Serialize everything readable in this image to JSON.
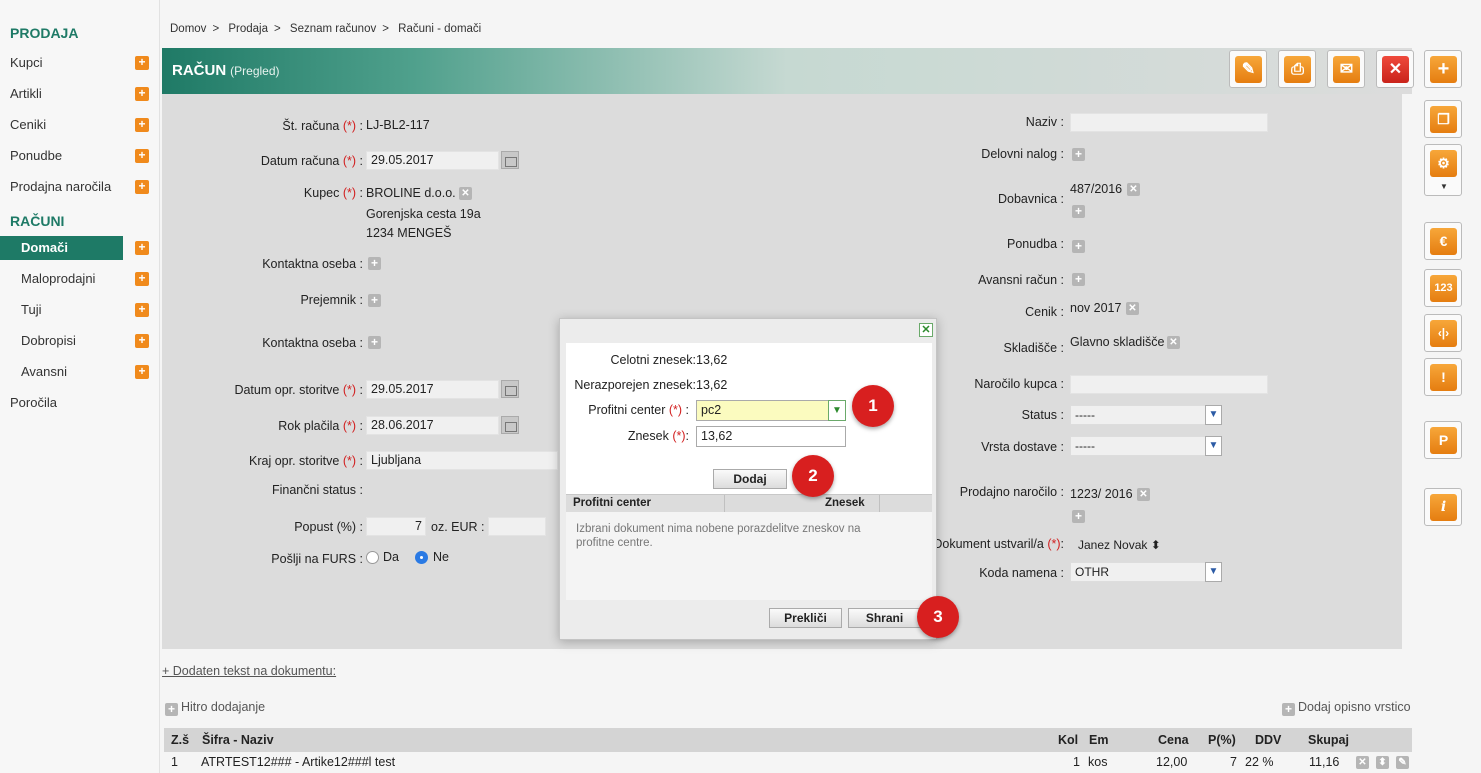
{
  "sidebar": {
    "section1": "PRODAJA",
    "items1": [
      "Kupci",
      "Artikli",
      "Ceniki",
      "Ponudbe",
      "Prodajna naročila"
    ],
    "section2": "RAČUNI",
    "items2": [
      "Domači",
      "Maloprodajni",
      "Tuji",
      "Dobropisi",
      "Avansni"
    ],
    "reports": "Poročila"
  },
  "breadcrumb": [
    "Domov",
    "Prodaja",
    "Seznam računov",
    "Računi - domači"
  ],
  "header": {
    "title": "RAČUN",
    "subtitle": "(Pregled)"
  },
  "form_left": {
    "invoice_no_label": "Št. računa",
    "invoice_no": "LJ-BL2-117",
    "invoice_date_label": "Datum računa",
    "invoice_date": "29.05.2017",
    "customer_label": "Kupec",
    "customer_name": "BROLINE d.o.o.",
    "customer_street": "Gorenjska cesta 19a",
    "customer_city": "1234 MENGEŠ",
    "contact_label": "Kontaktna oseba",
    "recipient_label": "Prejemnik",
    "contact2_label": "Kontaktna oseba",
    "service_date_label": "Datum opr. storitve",
    "service_date": "29.05.2017",
    "due_label": "Rok plačila",
    "due_date": "28.06.2017",
    "place_label": "Kraj opr. storitve",
    "place": "Ljubljana",
    "fin_status_label": "Finančni status :",
    "discount_label": "Popust (%) :",
    "discount": "7",
    "discount_eur_label": "oz. EUR :",
    "furs_label": "Pošlji na FURS :",
    "furs_da": "Da",
    "furs_ne": "Ne"
  },
  "form_right": {
    "name_label": "Naziv :",
    "work_order_label": "Delovni nalog :",
    "delivery_label": "Dobavnica :",
    "delivery_value": "487/2016",
    "offer_label": "Ponudba :",
    "advance_label": "Avansni račun :",
    "pricelist_label": "Cenik :",
    "pricelist_value": "nov 2017",
    "warehouse_label": "Skladišče :",
    "warehouse_value": "Glavno skladišče",
    "order_label": "Naročilo kupca :",
    "status_label": "Status :",
    "status_value": "-----",
    "shipping_label": "Vrsta dostave :",
    "shipping_value": "-----",
    "sales_order_label": "Prodajno naročilo :",
    "sales_order_value": "1223/ 2016",
    "created_by_label": "Dokument ustvaril/a",
    "created_by_value": "Janez Novak",
    "purpose_label": "Koda namena :",
    "purpose_value": "OTHR"
  },
  "modal": {
    "total_label": "Celotni znesek:",
    "total": "13,62",
    "unalloc_label": "Nerazporejen znesek:",
    "unalloc": "13,62",
    "profit_center_label": "Profitni center",
    "profit_center": "pc2",
    "amount_label": "Znesek",
    "amount": "13,62",
    "add_button": "Dodaj",
    "col_profit_center": "Profitni center",
    "col_amount": "Znesek",
    "empty_text": "Izbrani dokument nima nobene porazdelitve zneskov na profitne centre.",
    "cancel_button": "Prekliči",
    "save_button": "Shrani"
  },
  "badges": [
    "1",
    "2",
    "3"
  ],
  "required_mark": "(*)",
  "bottom": {
    "added_text": "+ Dodaten tekst na dokumentu:",
    "quick_add": "Hitro dodajanje",
    "desc_row": "Dodaj opisno vrstico",
    "columns": [
      "Z.š",
      "Šifra - Naziv",
      "Kol",
      "Em",
      "Cena",
      "P(%)",
      "DDV",
      "Skupaj"
    ],
    "row": [
      "1",
      "ATRTEST12### - Artike12###l test",
      "1",
      "kos",
      "12,00",
      "7",
      "22 %",
      "11,16"
    ]
  },
  "colors": {
    "brand": "#1e7a66",
    "accent": "#f08a1c",
    "danger": "#d81f1f"
  }
}
